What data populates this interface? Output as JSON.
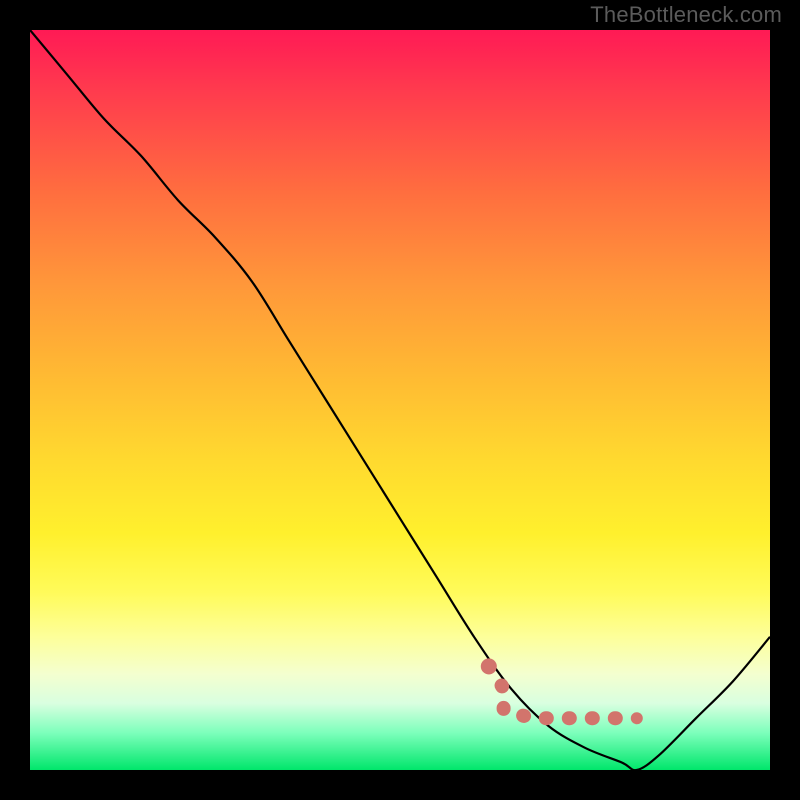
{
  "watermark": "TheBottleneck.com",
  "chart_data": {
    "type": "line",
    "title": "",
    "xlabel": "",
    "ylabel": "",
    "xlim": [
      0,
      100
    ],
    "ylim": [
      0,
      100
    ],
    "series": [
      {
        "name": "curve",
        "x": [
          0,
          5,
          10,
          15,
          20,
          25,
          30,
          35,
          40,
          45,
          50,
          55,
          60,
          65,
          70,
          75,
          80,
          82,
          85,
          90,
          95,
          100
        ],
        "y": [
          100,
          94,
          88,
          83,
          77,
          72,
          66,
          58,
          50,
          42,
          34,
          26,
          18,
          11,
          6,
          3,
          1,
          0,
          2,
          7,
          12,
          18
        ]
      }
    ],
    "marker_segment": {
      "name": "highlight",
      "x": [
        62,
        64,
        64,
        68,
        72,
        76,
        80,
        82
      ],
      "y": [
        14,
        11,
        8,
        7,
        7,
        7,
        7,
        7
      ]
    },
    "gradient_background": true
  }
}
